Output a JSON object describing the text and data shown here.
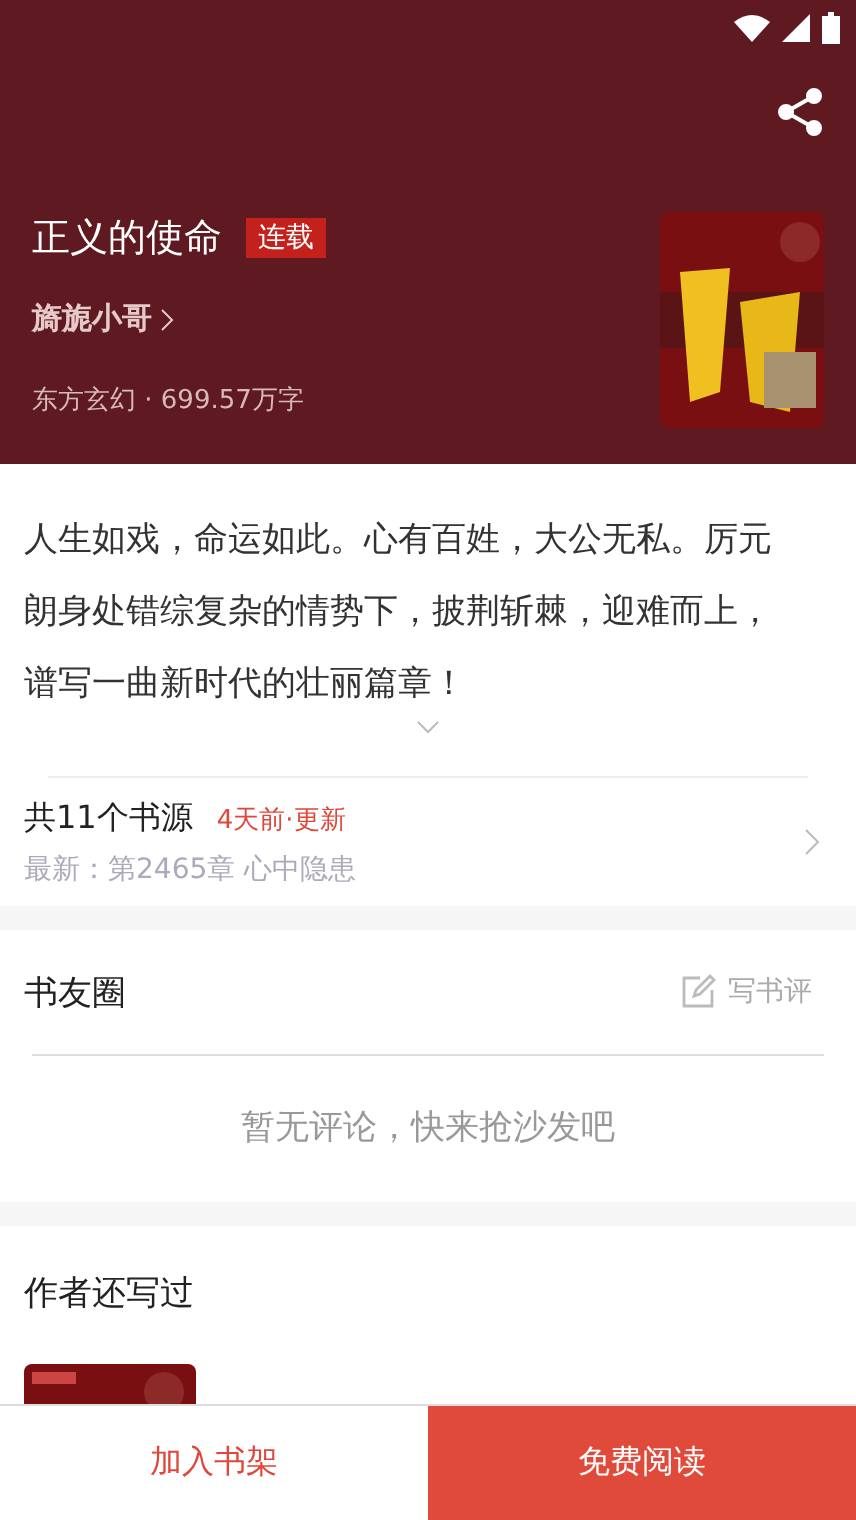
{
  "book": {
    "title": "正义的使命",
    "status_tag": "连载",
    "author": "旖旎小哥",
    "meta": "东方玄幻 · 699.57万字"
  },
  "description": "人生如戏，命运如此。心有百姓，大公无私。厉元朗身处错综复杂的情势下，披荆斩棘，迎难而上，谱写一曲新时代的壮丽篇章！",
  "sources": {
    "count_label": "共11个书源",
    "updated": "4天前·更新",
    "latest": "最新：第2465章 心中隐患"
  },
  "book_circle": {
    "title": "书友圈",
    "write_review": "写书评",
    "empty": "暂无评论，快来抢沙发吧"
  },
  "author_also_wrote": {
    "title": "作者还写过"
  },
  "bottom_bar": {
    "add_to_shelf": "加入书架",
    "read_free": "免费阅读"
  }
}
